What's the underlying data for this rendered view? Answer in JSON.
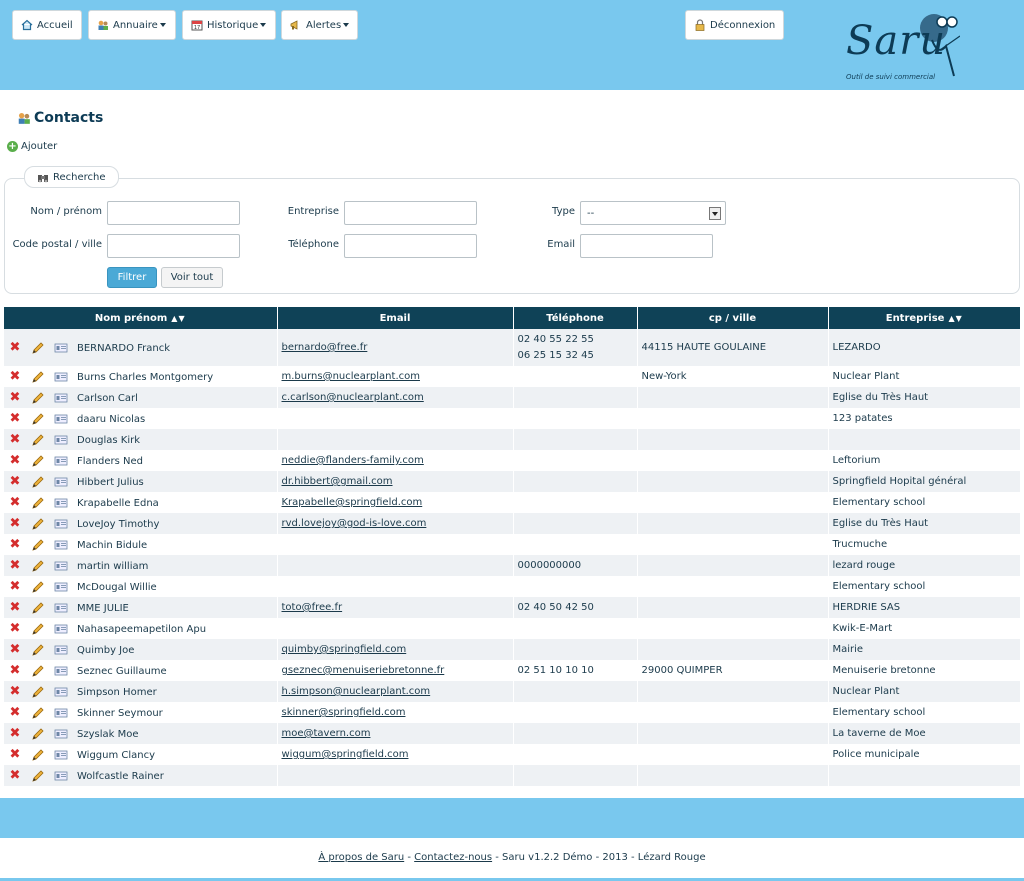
{
  "nav": {
    "home": "Accueil",
    "directory": "Annuaire",
    "history": "Historique",
    "alerts": "Alertes",
    "logout": "Déconnexion"
  },
  "logo": {
    "word": "Saru",
    "tagline": "Outil de suivi commercial"
  },
  "page": {
    "title": "Contacts",
    "add_label": "Ajouter"
  },
  "search": {
    "legend": "Recherche",
    "name_label": "Nom / prénom",
    "postal_label": "Code postal / ville",
    "company_label": "Entreprise",
    "phone_label": "Téléphone",
    "type_label": "Type",
    "email_label": "Email",
    "type_value": "--",
    "filter_button": "Filtrer",
    "show_all_button": "Voir tout"
  },
  "table": {
    "columns": [
      "Nom prénom",
      "Email",
      "Téléphone",
      "cp / ville",
      "Entreprise"
    ],
    "sort_glyph": "▲▼",
    "rows": [
      {
        "name": "BERNARDO Franck",
        "email": "bernardo@free.fr",
        "phone": "02 40 55 22 55",
        "phone2": "06 25 15 32 45",
        "city": "44115 HAUTE GOULAINE",
        "company": "LEZARDO"
      },
      {
        "name": "Burns Charles Montgomery",
        "email": "m.burns@nuclearplant.com",
        "phone": "",
        "city": "New-York",
        "company": "Nuclear Plant"
      },
      {
        "name": "Carlson Carl",
        "email": "c.carlson@nuclearplant.com",
        "phone": "",
        "city": "",
        "company": "Eglise du Très Haut"
      },
      {
        "name": "daaru Nicolas",
        "email": "",
        "phone": "",
        "city": "",
        "company": "123 patates"
      },
      {
        "name": "Douglas Kirk",
        "email": "",
        "phone": "",
        "city": "",
        "company": ""
      },
      {
        "name": "Flanders Ned",
        "email": "neddie@flanders-family.com",
        "phone": "",
        "city": "",
        "company": "Leftorium"
      },
      {
        "name": "Hibbert Julius",
        "email": "dr.hibbert@gmail.com",
        "phone": "",
        "city": "",
        "company": "Springfield Hopital général"
      },
      {
        "name": "Krapabelle Edna",
        "email": "Krapabelle@springfield.com",
        "phone": "",
        "city": "",
        "company": "Elementary school"
      },
      {
        "name": "LoveJoy Timothy",
        "email": "rvd.lovejoy@god-is-love.com",
        "phone": "",
        "city": "",
        "company": "Eglise du Très Haut"
      },
      {
        "name": "Machin Bidule",
        "email": "",
        "phone": "",
        "city": "",
        "company": "Trucmuche"
      },
      {
        "name": "martin william",
        "email": "",
        "phone": "0000000000",
        "city": "",
        "company": "lezard rouge"
      },
      {
        "name": "McDougal Willie",
        "email": "",
        "phone": "",
        "city": "",
        "company": "Elementary school"
      },
      {
        "name": "MME JULIE",
        "email": "toto@free.fr",
        "phone": "02 40 50 42 50",
        "city": "",
        "company": "HERDRIE SAS"
      },
      {
        "name": "Nahasapeemapetilon Apu",
        "email": "",
        "phone": "",
        "city": "",
        "company": "Kwik-E-Mart"
      },
      {
        "name": "Quimby Joe",
        "email": "quimby@springfield.com",
        "phone": "",
        "city": "",
        "company": "Mairie"
      },
      {
        "name": "Seznec Guillaume",
        "email": "gseznec@menuiseriebretonne.fr",
        "phone": "02 51 10 10 10",
        "city": "29000 QUIMPER",
        "company": "Menuiserie bretonne"
      },
      {
        "name": "Simpson Homer",
        "email": "h.simpson@nuclearplant.com",
        "phone": "",
        "city": "",
        "company": "Nuclear Plant"
      },
      {
        "name": "Skinner Seymour",
        "email": "skinner@springfield.com",
        "phone": "",
        "city": "",
        "company": "Elementary school"
      },
      {
        "name": "Szyslak Moe",
        "email": "moe@tavern.com",
        "phone": "",
        "city": "",
        "company": "La taverne de Moe"
      },
      {
        "name": "Wiggum Clancy",
        "email": "wiggum@springfield.com",
        "phone": "",
        "city": "",
        "company": "Police municipale"
      },
      {
        "name": "Wolfcastle Rainer",
        "email": "",
        "phone": "",
        "city": "",
        "company": ""
      }
    ]
  },
  "footer": {
    "about": "À propos de Saru",
    "sep1": " - ",
    "contact": "Contactez-nous",
    "rest": " - Saru v1.2.2 Démo - 2013 - Lézard Rouge"
  },
  "colors": {
    "header": "#79c8ee",
    "table_header": "#0f4257",
    "filter_button": "#4aa9d6",
    "delete": "#d42d2d"
  }
}
